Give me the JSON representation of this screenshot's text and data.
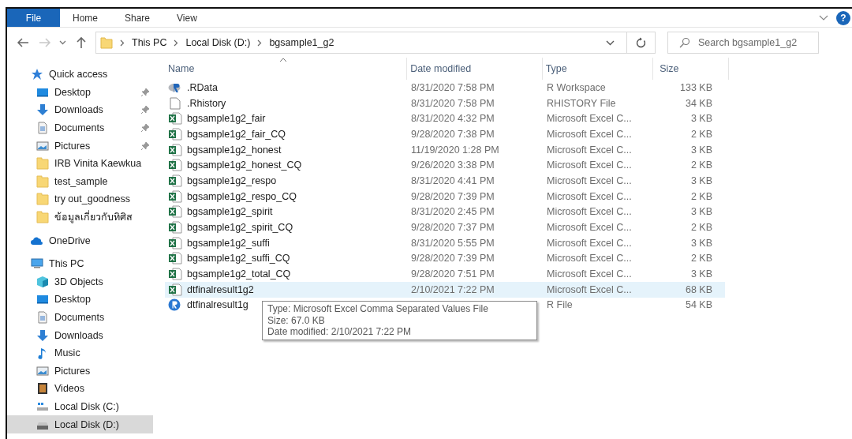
{
  "ribbon": {
    "tabs": [
      {
        "label": "File",
        "kind": "file"
      },
      {
        "label": "Home",
        "kind": "tab"
      },
      {
        "label": "Share",
        "kind": "tab"
      },
      {
        "label": "View",
        "kind": "tab"
      }
    ],
    "help": "?"
  },
  "address": {
    "path": [
      "This PC",
      "Local Disk (D:)",
      "bgsample1_g2"
    ]
  },
  "search": {
    "placeholder": "Search bgsample1_g2"
  },
  "sidebar": {
    "items": [
      {
        "label": "Quick access",
        "kind": "star",
        "pinned": false,
        "selected": false,
        "top": true
      },
      {
        "label": "Desktop",
        "kind": "desktop",
        "pinned": true,
        "selected": false,
        "top": false
      },
      {
        "label": "Downloads",
        "kind": "downloads",
        "pinned": true,
        "selected": false,
        "top": false
      },
      {
        "label": "Documents",
        "kind": "documents",
        "pinned": true,
        "selected": false,
        "top": false
      },
      {
        "label": "Pictures",
        "kind": "pictures",
        "pinned": true,
        "selected": false,
        "top": false
      },
      {
        "label": "IRB Vinita Kaewkua",
        "kind": "folder",
        "pinned": false,
        "selected": false,
        "top": false
      },
      {
        "label": "test_sample",
        "kind": "folder",
        "pinned": false,
        "selected": false,
        "top": false
      },
      {
        "label": "try out_goodness",
        "kind": "folder",
        "pinned": false,
        "selected": false,
        "top": false
      },
      {
        "label": "ข้อมูลเกี่ยวกับทิศิส",
        "kind": "folder",
        "pinned": false,
        "selected": false,
        "top": false
      },
      {
        "label": "OneDrive",
        "kind": "cloud",
        "pinned": false,
        "selected": false,
        "top": true
      },
      {
        "label": "This PC",
        "kind": "pc",
        "pinned": false,
        "selected": false,
        "top": true
      },
      {
        "label": "3D Objects",
        "kind": "cube",
        "pinned": false,
        "selected": false,
        "top": false
      },
      {
        "label": "Desktop",
        "kind": "desktop",
        "pinned": false,
        "selected": false,
        "top": false
      },
      {
        "label": "Documents",
        "kind": "documents",
        "pinned": false,
        "selected": false,
        "top": false
      },
      {
        "label": "Downloads",
        "kind": "downloads",
        "pinned": false,
        "selected": false,
        "top": false
      },
      {
        "label": "Music",
        "kind": "music",
        "pinned": false,
        "selected": false,
        "top": false
      },
      {
        "label": "Pictures",
        "kind": "pictures",
        "pinned": false,
        "selected": false,
        "top": false
      },
      {
        "label": "Videos",
        "kind": "videos",
        "pinned": false,
        "selected": false,
        "top": false
      },
      {
        "label": "Local Disk (C:)",
        "kind": "drive_c",
        "pinned": false,
        "selected": false,
        "top": false
      },
      {
        "label": "Local Disk (D:)",
        "kind": "drive",
        "pinned": false,
        "selected": true,
        "top": false
      }
    ]
  },
  "table": {
    "columns": [
      "Name",
      "Date modified",
      "Type",
      "Size"
    ],
    "rows": [
      {
        "kind": "rdata",
        "name": ".RData",
        "date": "8/31/2020 7:58 PM",
        "type": "R Workspace",
        "size": "133 KB",
        "hovered": false
      },
      {
        "kind": "text",
        "name": ".Rhistory",
        "date": "8/31/2020 7:58 PM",
        "type": "RHISTORY File",
        "size": "34 KB",
        "hovered": false
      },
      {
        "kind": "csv",
        "name": "bgsample1g2_fair",
        "date": "8/31/2020 4:32 PM",
        "type": "Microsoft Excel C...",
        "size": "3 KB",
        "hovered": false
      },
      {
        "kind": "csv",
        "name": "bgsample1g2_fair_CQ",
        "date": "9/28/2020 7:38 PM",
        "type": "Microsoft Excel C...",
        "size": "2 KB",
        "hovered": false
      },
      {
        "kind": "csv",
        "name": "bgsample1g2_honest",
        "date": "11/19/2020 1:28 PM",
        "type": "Microsoft Excel C...",
        "size": "3 KB",
        "hovered": false
      },
      {
        "kind": "csv",
        "name": "bgsample1g2_honest_CQ",
        "date": "9/26/2020 3:38 PM",
        "type": "Microsoft Excel C...",
        "size": "2 KB",
        "hovered": false
      },
      {
        "kind": "csv",
        "name": "bgsample1g2_respo",
        "date": "8/31/2020 4:41 PM",
        "type": "Microsoft Excel C...",
        "size": "3 KB",
        "hovered": false
      },
      {
        "kind": "csv",
        "name": "bgsample1g2_respo_CQ",
        "date": "9/28/2020 7:39 PM",
        "type": "Microsoft Excel C...",
        "size": "2 KB",
        "hovered": false
      },
      {
        "kind": "csv",
        "name": "bgsample1g2_spirit",
        "date": "8/31/2020 2:45 PM",
        "type": "Microsoft Excel C...",
        "size": "3 KB",
        "hovered": false
      },
      {
        "kind": "csv",
        "name": "bgsample1g2_spirit_CQ",
        "date": "9/28/2020 7:37 PM",
        "type": "Microsoft Excel C...",
        "size": "2 KB",
        "hovered": false
      },
      {
        "kind": "csv",
        "name": "bgsample1g2_suffi",
        "date": "8/31/2020 5:55 PM",
        "type": "Microsoft Excel C...",
        "size": "3 KB",
        "hovered": false
      },
      {
        "kind": "csv",
        "name": "bgsample1g2_suffi_CQ",
        "date": "9/28/2020 7:39 PM",
        "type": "Microsoft Excel C...",
        "size": "2 KB",
        "hovered": false
      },
      {
        "kind": "csv",
        "name": "bgsample1g2_total_CQ",
        "date": "9/28/2020 7:51 PM",
        "type": "Microsoft Excel C...",
        "size": "3 KB",
        "hovered": false
      },
      {
        "kind": "csv",
        "name": "dtfinalresult1g2",
        "date": "2/10/2021 7:22 PM",
        "type": "Microsoft Excel C...",
        "size": "68 KB",
        "hovered": true
      },
      {
        "kind": "r",
        "name": "dtfinalresult1g",
        "type": "R File",
        "size": "54 KB",
        "hovered": false
      }
    ]
  },
  "tooltip": {
    "lines": [
      "Type: Microsoft Excel Comma Separated Values File",
      "Size: 67.0 KB",
      "Date modified: 2/10/2021 7:22 PM"
    ]
  }
}
